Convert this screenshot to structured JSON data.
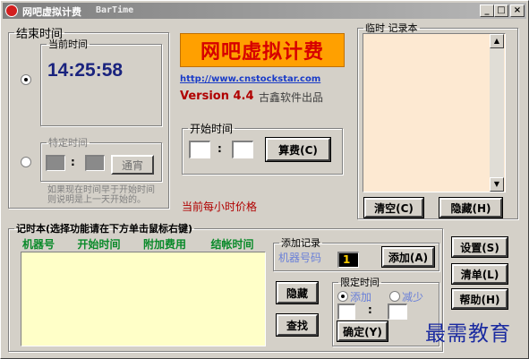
{
  "window": {
    "title": "网吧虚拟计费",
    "subtitle": "BarTime",
    "controls": {
      "minimize": "_",
      "maximize": "□",
      "close": "×"
    }
  },
  "end_time": {
    "group_label": "结束时间",
    "current": {
      "label": "当前时间",
      "value": "14:25:58",
      "color": "#1a237e"
    },
    "specific": {
      "label": "特定时间",
      "hour": "",
      "minute": "",
      "separator": ":",
      "overnight_button": "通宵"
    },
    "note": "如果现在时间早于开始时间\n则说明是上一天开始的。"
  },
  "brand": {
    "logo_text": "网吧虚拟计费",
    "url": "http://www.cnstockstar.com",
    "version": "Version 4.4",
    "publisher": "古鑫软件出品",
    "logo_bg": "#ffa000",
    "logo_color": "#d70000"
  },
  "start_time": {
    "group_label": "开始时间",
    "hour": "",
    "minute": "",
    "separator": ":",
    "calc_button": "算费(C)"
  },
  "hourly_price_label": "当前每小时价格",
  "notepad": {
    "group_label": "临时 记录本",
    "content": "",
    "clear_button": "清空(C)",
    "hide_button": "隐藏(H)",
    "bg": "#fde9d2"
  },
  "log": {
    "group_label": "记时本(选择功能请在下方单击鼠标右键)",
    "columns": [
      "机器号",
      "开始时间",
      "附加费用",
      "结帐时间"
    ],
    "rows": [],
    "bg": "#ffffc8",
    "header_color": "#0a8a2a"
  },
  "add_record": {
    "group_label": "添加记录",
    "machine_label": "机器号码",
    "machine_value": "1",
    "add_button": "添加(A)"
  },
  "limit_time": {
    "group_label": "限定时间",
    "add_option": "添加",
    "subtract_option": "减少",
    "hour": "",
    "minute": "",
    "separator": ":",
    "ok_button": "确定(Y)"
  },
  "side_buttons": {
    "hide": "隐藏",
    "find": "查找",
    "settings": "设置(S)",
    "clear_list": "清单(L)",
    "help": "帮助(H)"
  },
  "watermark": "最需教育"
}
